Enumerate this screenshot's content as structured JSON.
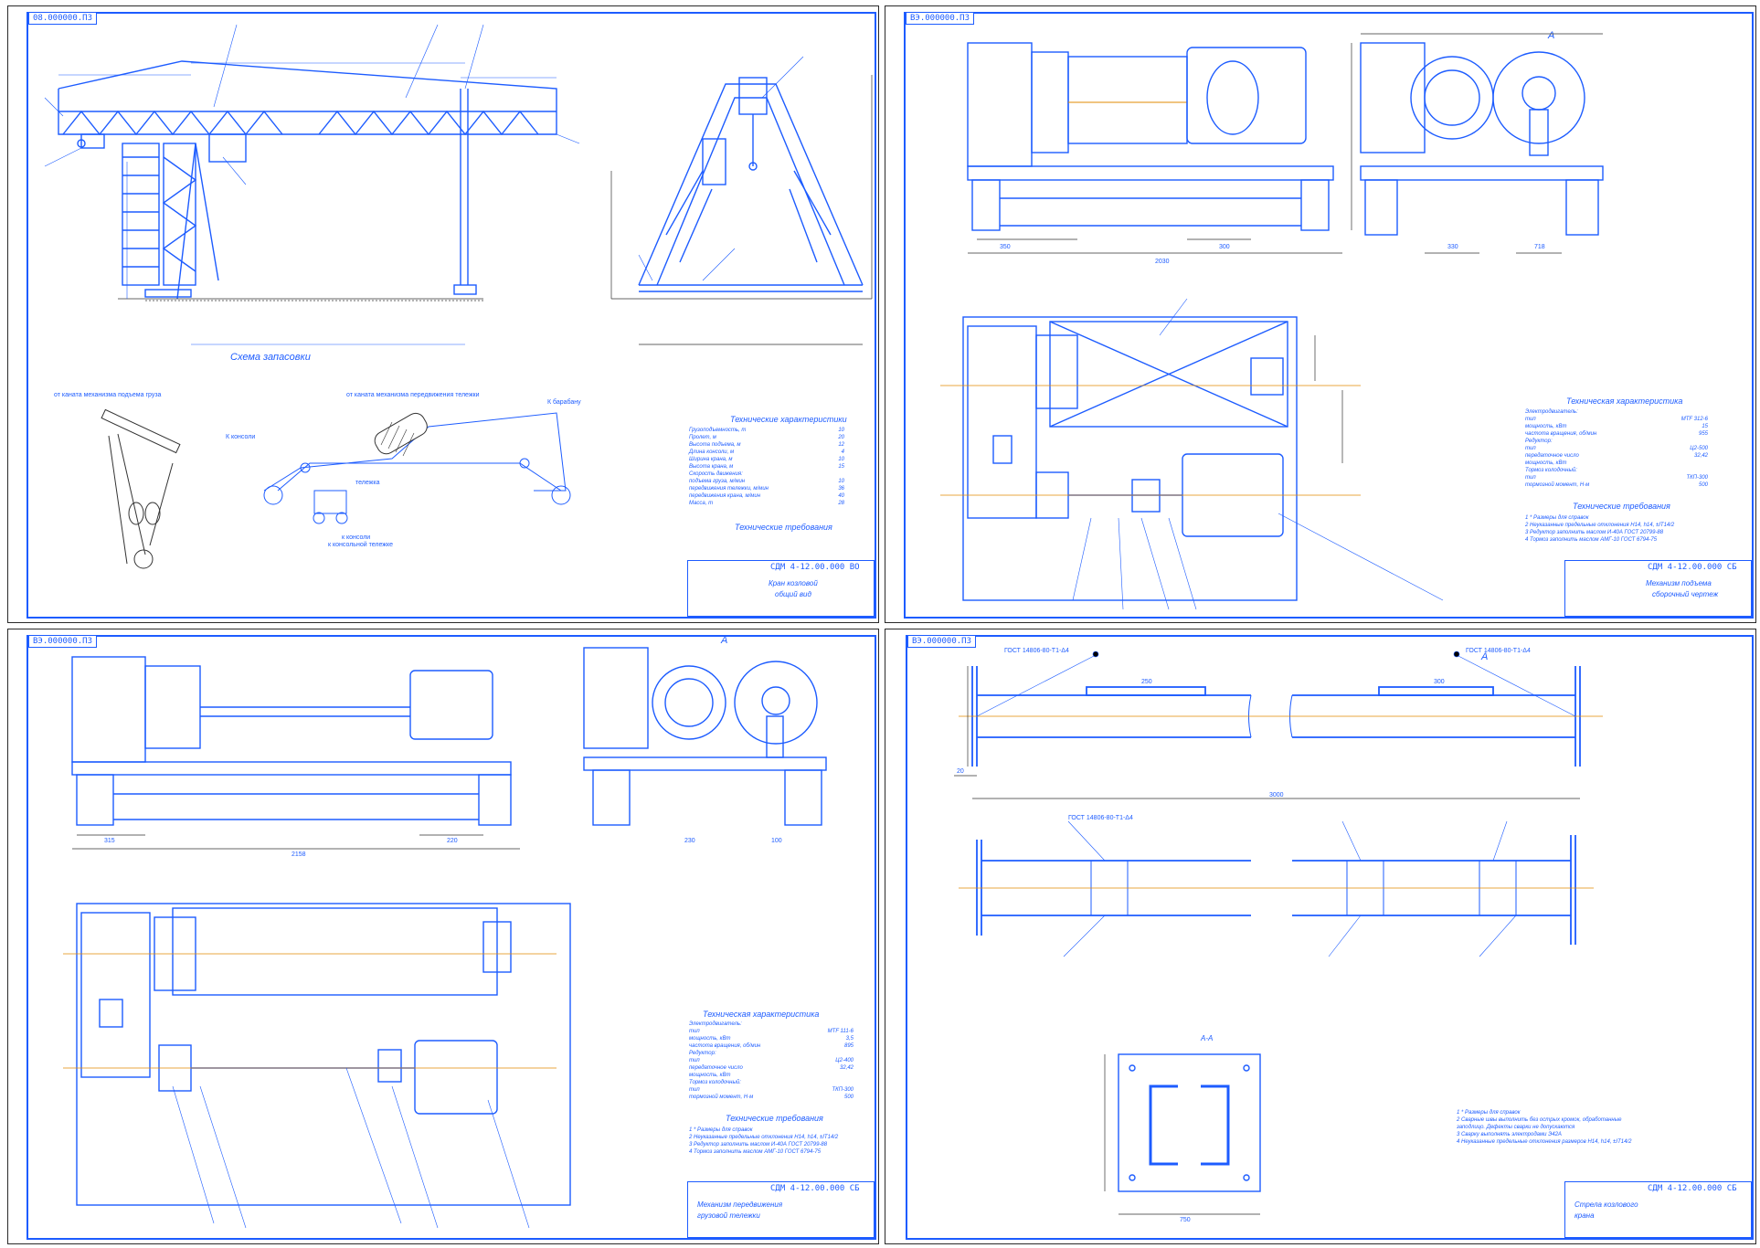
{
  "sheets": [
    {
      "stamp": "08.000000.ПЗ",
      "titleblock": {
        "code": "СДМ 4-12.00.000 ВО",
        "title": "Кран козловой",
        "subtitle": "общий вид"
      },
      "caption": "Схема запасовки",
      "spec_heading": "Технические характеристики",
      "req_heading": "Технические требования",
      "spec_lines": [
        "Грузоподъемность, т",
        "Пролет, м",
        "Высота подъема, м",
        "Длина консоли, м",
        "Ширина крана, м",
        "Высота крана, м",
        "Скорость движения:",
        "подъема груза, м/мин",
        "передвижения тележки, м/мин",
        "передвижения крана, м/мин",
        "Масса, т"
      ],
      "spec_values": [
        "10",
        "20",
        "12",
        "4",
        "10",
        "15",
        "",
        "10",
        "36",
        "40",
        "28"
      ],
      "rope_labels": [
        "К консоли",
        "К барабану",
        "тележка",
        "к консоли",
        "к консольной тележке"
      ],
      "notes": [
        "от каната механизма подъема груза",
        "от каната механизма передвижения тележки"
      ]
    },
    {
      "stamp": "ВЭ.000000.ПЗ",
      "titleblock": {
        "code": "СДМ 4-12.00.000 СБ",
        "title": "Механизм подъема",
        "subtitle": "сборочный чертеж"
      },
      "view_label": "А",
      "spec_heading": "Техническая характеристика",
      "req_heading": "Технические требования",
      "spec_lines": [
        "Электродвигатель:",
        "тип",
        "мощность, кВт",
        "частота вращения, об/мин",
        "Редуктор:",
        "тип",
        "передаточное число",
        "мощность, кВт",
        "Тормоз колодочный:",
        "тип",
        "тормозной момент, Н·м"
      ],
      "spec_values": [
        "",
        "MTF 312-6",
        "15",
        "955",
        "",
        "Ц2-500",
        "32,42",
        "",
        "",
        "ТКП-300",
        "500"
      ],
      "req_lines": [
        "1 * Размеры для справок",
        "2 Неуказанные предельные отклонения Н14, h14, ±IT14/2",
        "3 Редуктор заполнить маслом И-40А ГОСТ 20799-88",
        "4 Тормоз заполнить маслом АМГ-10 ГОСТ 6794-75"
      ],
      "dims": [
        "350",
        "2030",
        "300",
        "330",
        "718"
      ]
    },
    {
      "stamp": "ВЭ.000000.ПЗ",
      "titleblock": {
        "code": "СДМ 4-12.00.000 СБ",
        "title": "Механизм передвижения",
        "subtitle": "грузовой тележки"
      },
      "view_label": "А",
      "spec_heading": "Техническая характеристика",
      "req_heading": "Технические требования",
      "spec_lines": [
        "Электродвигатель:",
        "тип",
        "мощность, кВт",
        "частота вращения, об/мин",
        "Редуктор:",
        "тип",
        "передаточное число",
        "мощность, кВт",
        "Тормоз колодочный:",
        "тип",
        "тормозной момент, Н·м"
      ],
      "spec_values": [
        "",
        "MTF 111-6",
        "3,5",
        "895",
        "",
        "Ц2-400",
        "32,42",
        "",
        "",
        "ТКП-300",
        "500"
      ],
      "req_lines": [
        "1 * Размеры для справок",
        "2 Неуказанные предельные отклонения Н14, h14, ±IT14/2",
        "3 Редуктор заполнить маслом И-40А ГОСТ 20799-88",
        "4 Тормоз заполнить маслом АМГ-10 ГОСТ 6794-75"
      ],
      "dims": [
        "315",
        "2158",
        "220",
        "230",
        "100"
      ]
    },
    {
      "stamp": "ВЭ.000000.ПЗ",
      "titleblock": {
        "code": "СДМ 4-12.00.000 СБ",
        "title": "Стрела козлового",
        "subtitle": "крана"
      },
      "view_label": "А",
      "section_label": "А-А",
      "weld_notes": [
        "ГОСТ 14806-80-Т1-Δ4",
        "ГОСТ 14806-80-Т1-Δ4",
        "ГОСТ 14806-80-Т1-Δ4"
      ],
      "req_lines": [
        "1 * Размеры для справок",
        "2 Сварные швы выполнить без острых кромок, обработанные",
        "заподлицо. Дефекты сварки не допускаются",
        "3 Сварку выполнять электродами Э42А",
        "4 Неуказанные предельные отклонения размеров Н14, h14, ±IT14/2"
      ],
      "dims": [
        "20",
        "3000",
        "250",
        "300",
        "750"
      ]
    }
  ]
}
